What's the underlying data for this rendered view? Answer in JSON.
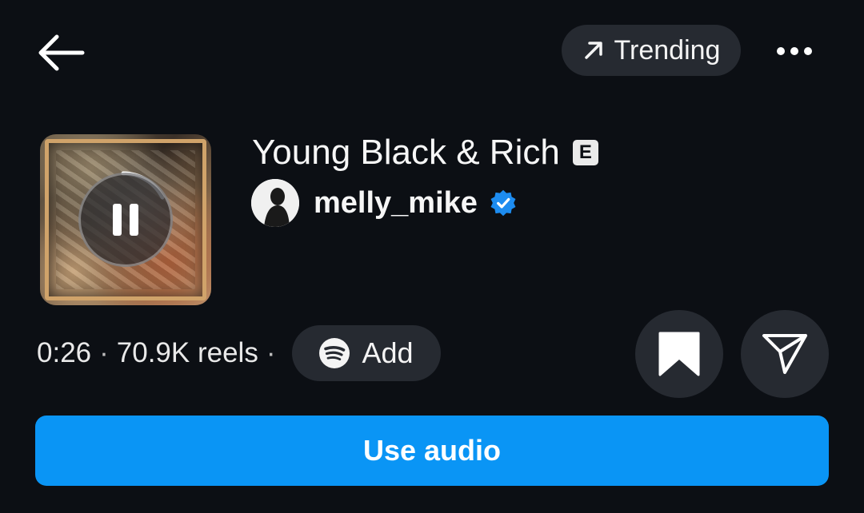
{
  "header": {
    "back_icon": "arrow-left-icon",
    "trending_label": "Trending",
    "trending_icon": "arrow-up-right-icon",
    "more_icon": "more-horizontal-icon"
  },
  "track": {
    "title": "Young Black & Rich",
    "explicit_badge": "E",
    "artist": "melly_mike",
    "artist_verified": true,
    "playback_state": "playing",
    "pause_icon": "pause-icon",
    "duration": "0:26",
    "reels_count": "70.9K reels",
    "separator": "·"
  },
  "actions": {
    "add_label": "Add",
    "add_icon": "spotify-icon",
    "save_icon": "bookmark-icon",
    "share_icon": "send-icon",
    "use_audio_label": "Use audio"
  },
  "colors": {
    "background": "#0c0f14",
    "pill": "#262a31",
    "primary": "#0a95f5",
    "verified": "#1d8cf0"
  }
}
